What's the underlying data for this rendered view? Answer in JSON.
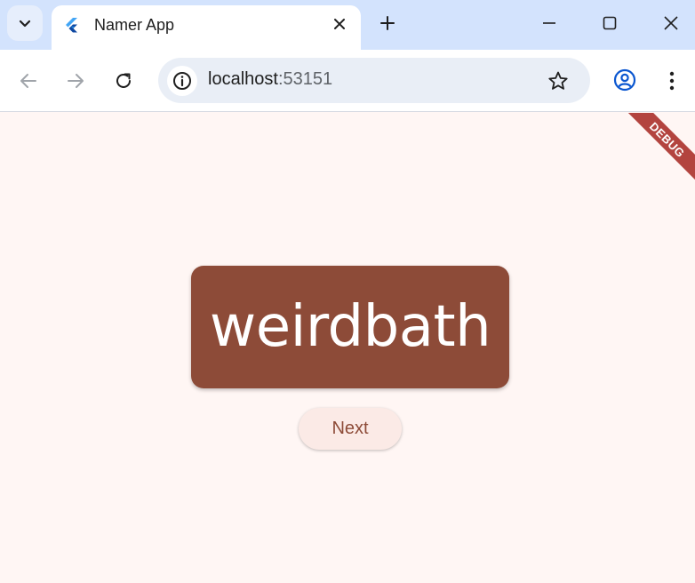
{
  "browser": {
    "tab": {
      "title": "Namer App",
      "favicon": "flutter-icon"
    },
    "window_controls": [
      "minimize-icon",
      "maximize-icon",
      "close-icon"
    ],
    "address": {
      "host": "localhost",
      "port": ":53151"
    }
  },
  "app": {
    "word": "weirdbath",
    "next_label": "Next",
    "debug_label": "DEBUG",
    "colors": {
      "primary": "#8d4b38",
      "background": "#fff6f4",
      "button_bg": "#fbeae6",
      "debug": "#b3443f"
    }
  }
}
